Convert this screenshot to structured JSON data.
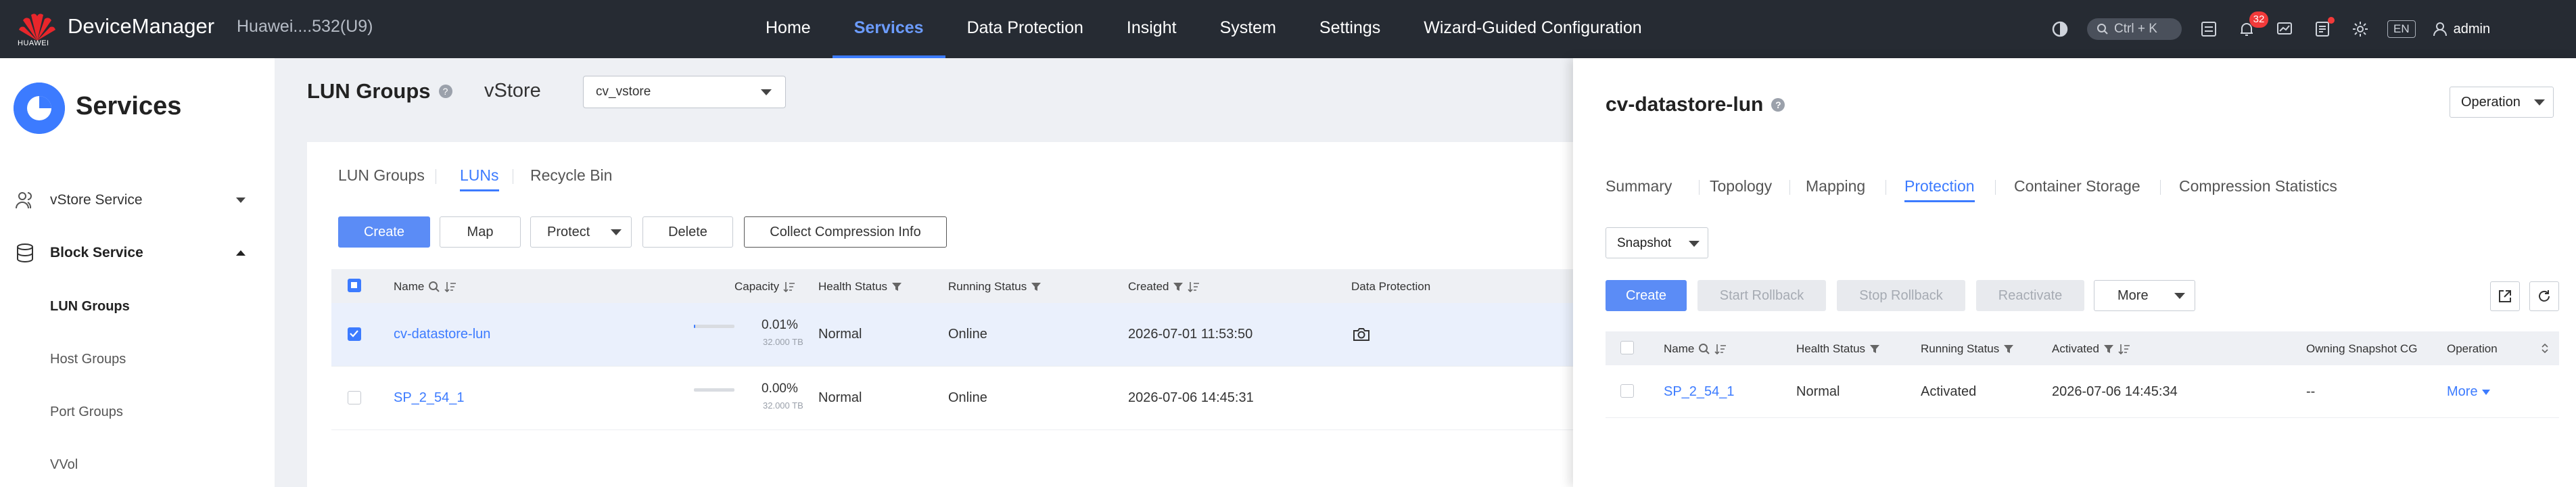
{
  "topbar": {
    "logo_text": "HUAWEI",
    "brand": "DeviceManager",
    "device": "Huawei....532(U9)",
    "nav": [
      "Home",
      "Services",
      "Data Protection",
      "Insight",
      "System",
      "Settings",
      "Wizard-Guided Configuration"
    ],
    "active_nav": "Services",
    "search_shortcut": "Ctrl + K",
    "notification_count": "32",
    "language": "EN",
    "user": "admin"
  },
  "sidebar": {
    "title": "Services",
    "vstore_service": "vStore Service",
    "block_service": "Block Service",
    "items": [
      "LUN Groups",
      "Host Groups",
      "Port Groups",
      "VVol"
    ],
    "active_item": "LUN Groups"
  },
  "main": {
    "title": "LUN Groups",
    "vstore_label": "vStore",
    "vstore_value": "cv_vstore",
    "tabs": [
      "LUN Groups",
      "LUNs",
      "Recycle Bin"
    ],
    "active_tab": "LUNs",
    "buttons": {
      "create": "Create",
      "map": "Map",
      "protect": "Protect",
      "delete": "Delete",
      "collect": "Collect Compression Info"
    },
    "columns": {
      "name": "Name",
      "capacity": "Capacity",
      "health": "Health Status",
      "running": "Running Status",
      "created": "Created",
      "protection": "Data Protection"
    },
    "rows": [
      {
        "name": "cv-datastore-lun",
        "capacity_pct": "0.01%",
        "capacity_total": "32.000 TB",
        "fill": 0.01,
        "health": "Normal",
        "running": "Online",
        "created": "2026-07-01 11:53:50",
        "selected": true
      },
      {
        "name": "SP_2_54_1",
        "capacity_pct": "0.00%",
        "capacity_total": "32.000 TB",
        "fill": 0.0,
        "health": "Normal",
        "running": "Online",
        "created": "2026-07-06 14:45:31",
        "selected": false
      }
    ]
  },
  "drawer": {
    "title": "cv-datastore-lun",
    "operation": "Operation",
    "tabs": [
      "Summary",
      "Topology",
      "Mapping",
      "Protection",
      "Container Storage",
      "Compression Statistics"
    ],
    "active_tab": "Protection",
    "snapshot_select": "Snapshot",
    "buttons": {
      "create": "Create",
      "start_rollback": "Start Rollback",
      "stop_rollback": "Stop Rollback",
      "reactivate": "Reactivate",
      "more": "More"
    },
    "columns": {
      "name": "Name",
      "health": "Health Status",
      "running": "Running Status",
      "activated": "Activated",
      "owning": "Owning Snapshot CG",
      "operation": "Operation"
    },
    "row": {
      "name": "SP_2_54_1",
      "health": "Normal",
      "running": "Activated",
      "activated": "2026-07-06 14:45:34",
      "owning": "--",
      "operation": "More"
    }
  },
  "colors": {
    "accent": "#3c7bff",
    "topbar": "#262b33",
    "badge": "#f23a3a"
  }
}
